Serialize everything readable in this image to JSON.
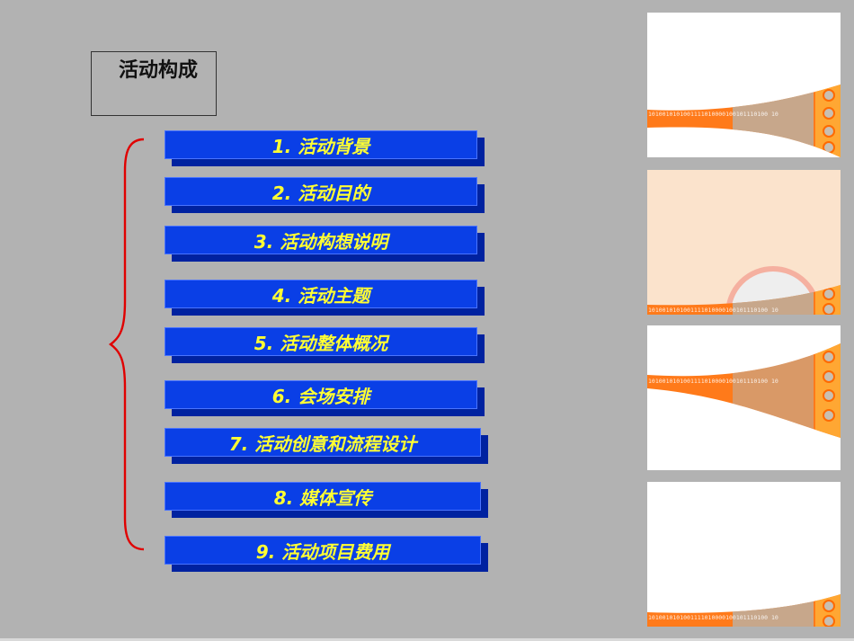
{
  "slide": {
    "title": "活动构成",
    "items": [
      {
        "label": "1. 活动背景"
      },
      {
        "label": "2. 活动目的"
      },
      {
        "label": "3. 活动构想说明"
      },
      {
        "label": "4. 活动主题"
      },
      {
        "label": "5. 活动整体概况"
      },
      {
        "label": "6. 会场安排"
      },
      {
        "label": "7. 活动创意和流程设计"
      },
      {
        "label": "8.  媒体宣传"
      },
      {
        "label": "9.  活动项目费用"
      }
    ]
  },
  "thumbnails": [
    {
      "name": "template-thumbnail-1",
      "binary_text": "1010010101001111010000100101110100 10"
    },
    {
      "name": "template-thumbnail-2",
      "binary_text": "1010010101001111010000100101110100 10"
    },
    {
      "name": "template-thumbnail-3",
      "binary_text": "1010010101001111010000100101110100 10"
    },
    {
      "name": "template-thumbnail-4",
      "binary_text": "1010010101001111010000100101110100 10"
    }
  ],
  "colors": {
    "background": "#b2b2b2",
    "button_face": "#0a3fe6",
    "button_shadow": "#0022a0",
    "button_text": "#ffff33",
    "brace": "#e00000",
    "accent_orange": "#ff6a00"
  }
}
